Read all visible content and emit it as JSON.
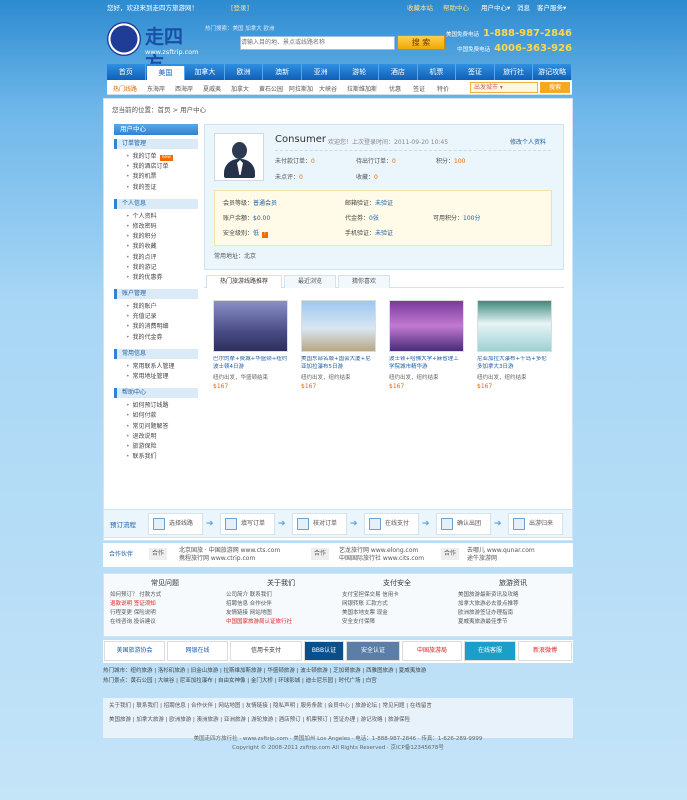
{
  "topbar": {
    "greeting": "您好，欢迎来到走四方旅游网！",
    "login": "[登录]",
    "register": "[免费注册]",
    "fav": "收藏本站",
    "help": "帮助中心",
    "dropdown1": "用户中心▾",
    "msg": "消息",
    "dropdown2": "客户服务▾"
  },
  "brand": {
    "name": "走四方",
    "domain": "www.zsftrip.com",
    "hot": "热门搜索：美国 加拿大 欧洲"
  },
  "search": {
    "placeholder": "请输入目的地、景点或线路名称",
    "button": "搜 索"
  },
  "phones": {
    "label1": "美国免费电话",
    "num1": "1-888-987-2846",
    "label2": "中国免费电话",
    "num2": "4006-363-926"
  },
  "nav": [
    "首页",
    "美国",
    "加拿大",
    "欧洲",
    "澳新",
    "亚洲",
    "游轮",
    "酒店",
    "机票",
    "签证",
    "旅行社",
    "游记攻略"
  ],
  "subnav": [
    "热门线路",
    "东海岸",
    "西海岸",
    "夏威夷",
    "加拿大",
    "黄石公园",
    "阿拉斯加",
    "大峡谷",
    "拉斯维加斯",
    "优惠",
    "签证",
    "特价"
  ],
  "trip": {
    "placeholder": "出发城市 ▾",
    "button": "搜索"
  },
  "crumb": "您当前的位置：首页 > 用户中心",
  "sidebar": {
    "title": "用户中心",
    "sections": [
      {
        "title": "订单管理",
        "items": [
          "我的订单",
          "我的酒店订单",
          "我的机票",
          "我的签证"
        ]
      },
      {
        "title": "个人信息",
        "items": [
          "个人资料",
          "修改密码",
          "我的积分",
          "我的收藏",
          "我的点评",
          "我的游记",
          "我的优惠券"
        ]
      },
      {
        "title": "账户管理",
        "items": [
          "我的账户",
          "充值记录",
          "我的消费明细",
          "我的代金券"
        ]
      },
      {
        "title": "常用信息",
        "items": [
          "常用联系人管理",
          "常用地址管理"
        ]
      },
      {
        "title": "帮助中心",
        "items": [
          "如何预订线路",
          "如何付款",
          "常见问题解答",
          "退改说明",
          "旅游保险",
          "联系我们"
        ]
      }
    ]
  },
  "user": {
    "name": "Consumer",
    "info": "欢迎您！上次登录时间：2011-09-20 10:45",
    "edit": "修改个人资料",
    "stats": [
      {
        "label": "未付款订单：",
        "val": "0"
      },
      {
        "label": "待出行订单：",
        "val": "0"
      },
      {
        "label": "积分：",
        "val": "100"
      },
      {
        "label": "未点评：",
        "val": "0"
      },
      {
        "label": "收藏：",
        "val": "0"
      }
    ]
  },
  "security": {
    "rows": [
      [
        "会员等级：",
        "普通会员",
        "邮箱验证：",
        "未验证"
      ],
      [
        "账户余额：",
        "$0.00",
        "代金券：",
        "0张",
        "可用积分：",
        "100分"
      ],
      [
        "安全级别：",
        "低",
        "手机验证：",
        "未验证"
      ]
    ]
  },
  "address": "常用地址：北京",
  "tabs": [
    "热门旅游线路推荐",
    "最近浏览",
    "猜你喜欢"
  ],
  "products": [
    {
      "title": "巴尔的摩+费城+华盛顿+纽约波士顿4日游",
      "city": "纽约出发，华盛顿结束",
      "price": "$167",
      "colorA": "#6f6ea8",
      "colorB": "#3a3a66"
    },
    {
      "title": "美国东部名城+国会大厦+尼亚加拉瀑布5日游",
      "city": "纽约出发，纽约结束",
      "price": "$167",
      "colorA": "#9fc6ea",
      "colorB": "#c9b894"
    },
    {
      "title": "波士顿+哈佛大学+麻省理工学院城市精华游",
      "city": "纽约出发，纽约结束",
      "price": "$167",
      "colorA": "#6a2c8a",
      "colorB": "#d080d0"
    },
    {
      "title": "尼亚加拉大瀑布+千岛+多伦多加拿大3日游",
      "city": "纽约出发，纽约结束",
      "price": "$167",
      "colorA": "#4a9a8a",
      "colorB": "#e0f2f4"
    }
  ],
  "steps": {
    "label": "预订流程",
    "items": [
      "选择线路",
      "填写订单",
      "核对订单",
      "在线支付",
      "确认出团",
      "出游归来"
    ]
  },
  "partners": {
    "label": "合作伙伴",
    "p1_tag": "合作",
    "p1a": "北京国旅 · 中国旅游网 www.cts.com",
    "p1b": "携程旅行网 www.ctrip.com",
    "p2_tag": "合作",
    "p2a": "艺龙旅行网 www.elong.com",
    "p2b": "中国国际旅行社 www.cits.com",
    "p3_tag": "合作",
    "p3a": "去哪儿 www.qunar.com",
    "p3b": "途牛旅游网"
  },
  "help": [
    {
      "title": "常见问题",
      "lines": [
        "如何预订？ 付款方式",
        "退款说明 签证须知",
        "行程变更 保险说明",
        "在线咨询 投诉建议"
      ]
    },
    {
      "title": "关于我们",
      "lines": [
        "公司简介 联系我们",
        "招聘信息 合作伙伴",
        "友情链接 网站地图",
        "中国国家旅游局认证旅行社"
      ]
    },
    {
      "title": "支付安全",
      "lines": [
        "支付宝担保交易 信用卡",
        "网银转账 汇款方式",
        "美国本地支票 现金",
        "安全支付保障"
      ]
    },
    {
      "title": "旅游资讯",
      "lines": [
        "美国旅游最新资讯及攻略",
        "加拿大旅游必去景点推荐",
        "欧洲旅游签证办理指南",
        "夏威夷旅游最佳季节"
      ]
    }
  ],
  "logos": [
    "美国旅游协会",
    "网银在线",
    "信用卡支付",
    "BBB认证",
    "安全认证",
    "中国旅游局",
    "在线客服",
    "新浪微博"
  ],
  "links": {
    "l1": "热门城市：纽约旅游 | 洛杉矶旅游 | 旧金山旅游 | 拉斯维加斯旅游 | 华盛顿旅游 | 波士顿旅游 | 芝加哥旅游 | 西雅图旅游 | 夏威夷旅游",
    "l2": "热门景点：黄石公园 | 大峡谷 | 尼亚加拉瀑布 | 自由女神像 | 金门大桥 | 环球影城 | 迪士尼乐园 | 时代广场 | 白宫"
  },
  "foot": {
    "l1": "关于我们 | 联系我们 | 招聘信息 | 合作伙伴 | 网站地图 | 友情链接 | 隐私声明 | 服务条款 | 会员中心 | 旅游论坛 | 常见问题 | 在线留言",
    "l2": "美国旅游 | 加拿大旅游 | 欧洲旅游 | 澳洲旅游 | 亚洲旅游 | 游轮旅游 | 酒店预订 | 机票预订 | 签证办理 | 游记攻略 | 旅游保险"
  },
  "copyright": {
    "l1": "美国走四方旅行社 · www.zsftrip.com · 美国加州 Los Angeles · 电话：1-888-987-2846 · 传真：1-626-289-9999",
    "l2": "Copyright © 2008-2011 zsftrip.com All Rights Reserved · 京ICP备12345678号"
  }
}
